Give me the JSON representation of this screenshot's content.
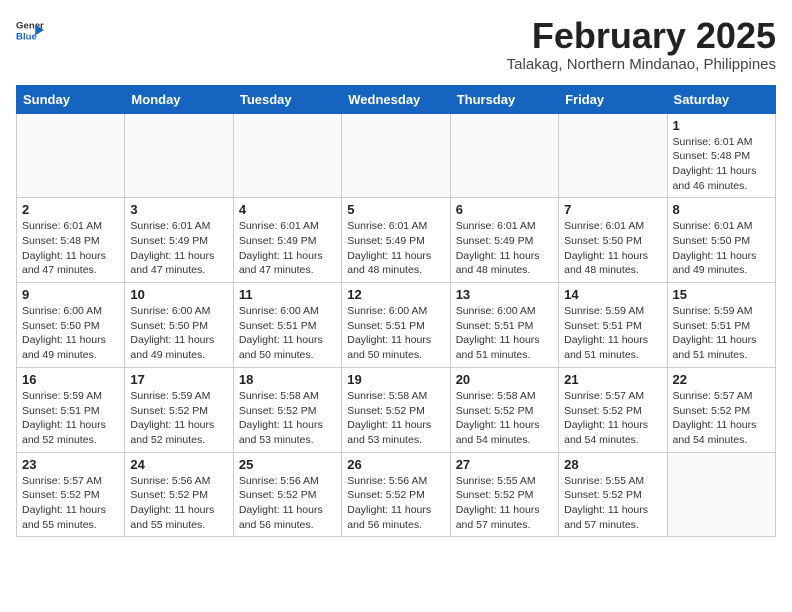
{
  "header": {
    "logo_general": "General",
    "logo_blue": "Blue",
    "title": "February 2025",
    "subtitle": "Talakag, Northern Mindanao, Philippines"
  },
  "weekdays": [
    "Sunday",
    "Monday",
    "Tuesday",
    "Wednesday",
    "Thursday",
    "Friday",
    "Saturday"
  ],
  "weeks": [
    [
      {
        "day": "",
        "info": ""
      },
      {
        "day": "",
        "info": ""
      },
      {
        "day": "",
        "info": ""
      },
      {
        "day": "",
        "info": ""
      },
      {
        "day": "",
        "info": ""
      },
      {
        "day": "",
        "info": ""
      },
      {
        "day": "1",
        "info": "Sunrise: 6:01 AM\nSunset: 5:48 PM\nDaylight: 11 hours and 46 minutes."
      }
    ],
    [
      {
        "day": "2",
        "info": "Sunrise: 6:01 AM\nSunset: 5:48 PM\nDaylight: 11 hours and 47 minutes."
      },
      {
        "day": "3",
        "info": "Sunrise: 6:01 AM\nSunset: 5:49 PM\nDaylight: 11 hours and 47 minutes."
      },
      {
        "day": "4",
        "info": "Sunrise: 6:01 AM\nSunset: 5:49 PM\nDaylight: 11 hours and 47 minutes."
      },
      {
        "day": "5",
        "info": "Sunrise: 6:01 AM\nSunset: 5:49 PM\nDaylight: 11 hours and 48 minutes."
      },
      {
        "day": "6",
        "info": "Sunrise: 6:01 AM\nSunset: 5:49 PM\nDaylight: 11 hours and 48 minutes."
      },
      {
        "day": "7",
        "info": "Sunrise: 6:01 AM\nSunset: 5:50 PM\nDaylight: 11 hours and 48 minutes."
      },
      {
        "day": "8",
        "info": "Sunrise: 6:01 AM\nSunset: 5:50 PM\nDaylight: 11 hours and 49 minutes."
      }
    ],
    [
      {
        "day": "9",
        "info": "Sunrise: 6:00 AM\nSunset: 5:50 PM\nDaylight: 11 hours and 49 minutes."
      },
      {
        "day": "10",
        "info": "Sunrise: 6:00 AM\nSunset: 5:50 PM\nDaylight: 11 hours and 49 minutes."
      },
      {
        "day": "11",
        "info": "Sunrise: 6:00 AM\nSunset: 5:51 PM\nDaylight: 11 hours and 50 minutes."
      },
      {
        "day": "12",
        "info": "Sunrise: 6:00 AM\nSunset: 5:51 PM\nDaylight: 11 hours and 50 minutes."
      },
      {
        "day": "13",
        "info": "Sunrise: 6:00 AM\nSunset: 5:51 PM\nDaylight: 11 hours and 51 minutes."
      },
      {
        "day": "14",
        "info": "Sunrise: 5:59 AM\nSunset: 5:51 PM\nDaylight: 11 hours and 51 minutes."
      },
      {
        "day": "15",
        "info": "Sunrise: 5:59 AM\nSunset: 5:51 PM\nDaylight: 11 hours and 51 minutes."
      }
    ],
    [
      {
        "day": "16",
        "info": "Sunrise: 5:59 AM\nSunset: 5:51 PM\nDaylight: 11 hours and 52 minutes."
      },
      {
        "day": "17",
        "info": "Sunrise: 5:59 AM\nSunset: 5:52 PM\nDaylight: 11 hours and 52 minutes."
      },
      {
        "day": "18",
        "info": "Sunrise: 5:58 AM\nSunset: 5:52 PM\nDaylight: 11 hours and 53 minutes."
      },
      {
        "day": "19",
        "info": "Sunrise: 5:58 AM\nSunset: 5:52 PM\nDaylight: 11 hours and 53 minutes."
      },
      {
        "day": "20",
        "info": "Sunrise: 5:58 AM\nSunset: 5:52 PM\nDaylight: 11 hours and 54 minutes."
      },
      {
        "day": "21",
        "info": "Sunrise: 5:57 AM\nSunset: 5:52 PM\nDaylight: 11 hours and 54 minutes."
      },
      {
        "day": "22",
        "info": "Sunrise: 5:57 AM\nSunset: 5:52 PM\nDaylight: 11 hours and 54 minutes."
      }
    ],
    [
      {
        "day": "23",
        "info": "Sunrise: 5:57 AM\nSunset: 5:52 PM\nDaylight: 11 hours and 55 minutes."
      },
      {
        "day": "24",
        "info": "Sunrise: 5:56 AM\nSunset: 5:52 PM\nDaylight: 11 hours and 55 minutes."
      },
      {
        "day": "25",
        "info": "Sunrise: 5:56 AM\nSunset: 5:52 PM\nDaylight: 11 hours and 56 minutes."
      },
      {
        "day": "26",
        "info": "Sunrise: 5:56 AM\nSunset: 5:52 PM\nDaylight: 11 hours and 56 minutes."
      },
      {
        "day": "27",
        "info": "Sunrise: 5:55 AM\nSunset: 5:52 PM\nDaylight: 11 hours and 57 minutes."
      },
      {
        "day": "28",
        "info": "Sunrise: 5:55 AM\nSunset: 5:52 PM\nDaylight: 11 hours and 57 minutes."
      },
      {
        "day": "",
        "info": ""
      }
    ]
  ]
}
